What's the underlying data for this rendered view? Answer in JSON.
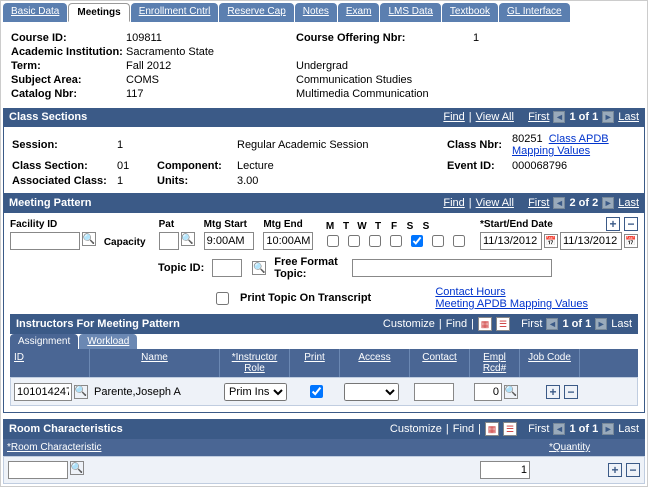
{
  "tabs": [
    "Basic Data",
    "Meetings",
    "Enrollment Cntrl",
    "Reserve Cap",
    "Notes",
    "Exam",
    "LMS Data",
    "Textbook",
    "GL Interface"
  ],
  "active_tab": 1,
  "header": {
    "labels": {
      "course_id": "Course ID:",
      "academic_institution": "Academic Institution:",
      "term": "Term:",
      "subject_area": "Subject Area:",
      "catalog_nbr": "Catalog Nbr:",
      "course_offering_nbr": "Course Offering Nbr:"
    },
    "course_id": "109811",
    "academic_institution": "Sacramento State",
    "term": "Fall 2012",
    "subject_area": "COMS",
    "catalog_nbr": "117",
    "course_offering_nbr": "1",
    "level": "Undergrad",
    "subject_desc": "Communication Studies",
    "catalog_desc": "Multimedia Communication"
  },
  "nav": {
    "find": "Find",
    "view_all": "View All",
    "first": "First",
    "last": "Last",
    "customize": "Customize"
  },
  "class_sections": {
    "title": "Class Sections",
    "count": "1 of 1",
    "session_label": "Session:",
    "session": "1",
    "session_desc": "Regular Academic Session",
    "class_nbr_label": "Class Nbr:",
    "class_nbr": "80251",
    "apdb_link": "Class APDB Mapping Values",
    "class_section_label": "Class Section:",
    "class_section": "01",
    "component_label": "Component:",
    "component": "Lecture",
    "event_id_label": "Event ID:",
    "event_id": "000068796",
    "associated_class_label": "Associated Class:",
    "associated_class": "1",
    "units_label": "Units:",
    "units": "3.00"
  },
  "meeting_pattern": {
    "title": "Meeting Pattern",
    "count": "2 of 2",
    "facility_id_label": "Facility ID",
    "capacity_label": "Capacity",
    "pat_label": "Pat",
    "mtg_start_label": "Mtg Start",
    "mtg_end_label": "Mtg End",
    "days": [
      "M",
      "T",
      "W",
      "T",
      "F",
      "S",
      "S"
    ],
    "start_end_label": "*Start/End Date",
    "facility_id": "",
    "capacity": "",
    "pat": "",
    "mtg_start": "9:00AM",
    "mtg_end": "10:00AM",
    "day_checks": [
      false,
      false,
      false,
      false,
      true,
      false,
      false
    ],
    "start_date": "11/13/2012",
    "end_date": "11/13/2012",
    "topic_id_label": "Topic ID:",
    "topic_id": "",
    "free_format_label": "Free Format Topic:",
    "free_format": "",
    "print_topic_label": "Print Topic On Transcript",
    "print_topic": false,
    "contact_hours_link": "Contact Hours",
    "meeting_apdb_link": "Meeting APDB Mapping Values"
  },
  "instructors": {
    "title": "Instructors For Meeting Pattern",
    "count": "1 of 1",
    "subtabs": [
      "Assignment",
      "Workload"
    ],
    "active_subtab": 0,
    "cols": {
      "id": "ID",
      "name": "Name",
      "instructor_role": "*Instructor Role",
      "print": "Print",
      "access": "Access",
      "contact": "Contact",
      "empl_rcd": "Empl Rcd#",
      "job_code": "Job Code"
    },
    "row": {
      "id": "101014247",
      "name": "Parente,Joseph A",
      "role": "Prim Ins",
      "print": true,
      "access": "",
      "contact": "",
      "empl_rcd": "0"
    }
  },
  "room_char": {
    "title": "Room Characteristics",
    "count": "1 of 1",
    "col_char": "*Room Characteristic",
    "col_qty": "*Quantity",
    "char": "",
    "qty": "1"
  }
}
